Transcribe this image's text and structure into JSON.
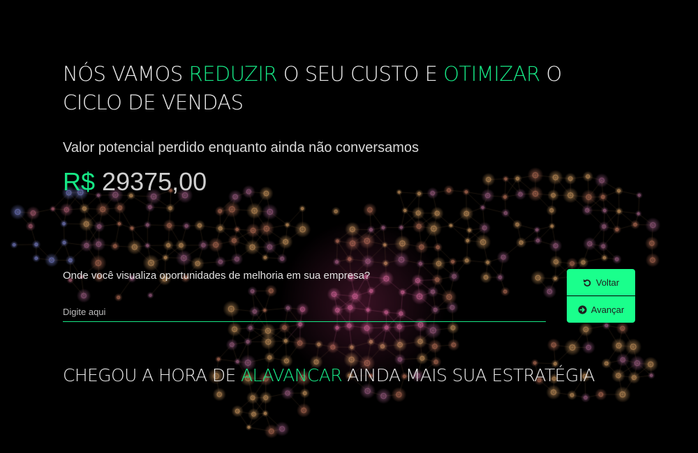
{
  "headline": {
    "part1": "NÓS VAMOS ",
    "highlight1": "REDUZIR",
    "part2": " O SEU CUSTO E ",
    "highlight2": "OTIMIZAR",
    "part3": " O CICLO DE VENDAS"
  },
  "lost_value": {
    "label": "Valor potencial perdido enquanto ainda não conversamos",
    "currency": "R$",
    "amount": "29375,00"
  },
  "form": {
    "question": "Onde você visualiza oportunidades de melhoria em sua empresa?",
    "answer_placeholder": "Digite aqui",
    "answer_value": ""
  },
  "buttons": {
    "back_label": "Voltar",
    "back_icon": "undo-icon",
    "next_label": "Avançar",
    "next_icon": "arrow-circle-right-icon"
  },
  "cta": {
    "part1": "CHEGOU A HORA DE ",
    "highlight": "ALAVANCAR",
    "part2": " AINDA MAIS SUA ESTRATÉGIA"
  },
  "colors": {
    "accent": "#16e785",
    "button_bg": "#1aff8c",
    "background": "#000000"
  }
}
